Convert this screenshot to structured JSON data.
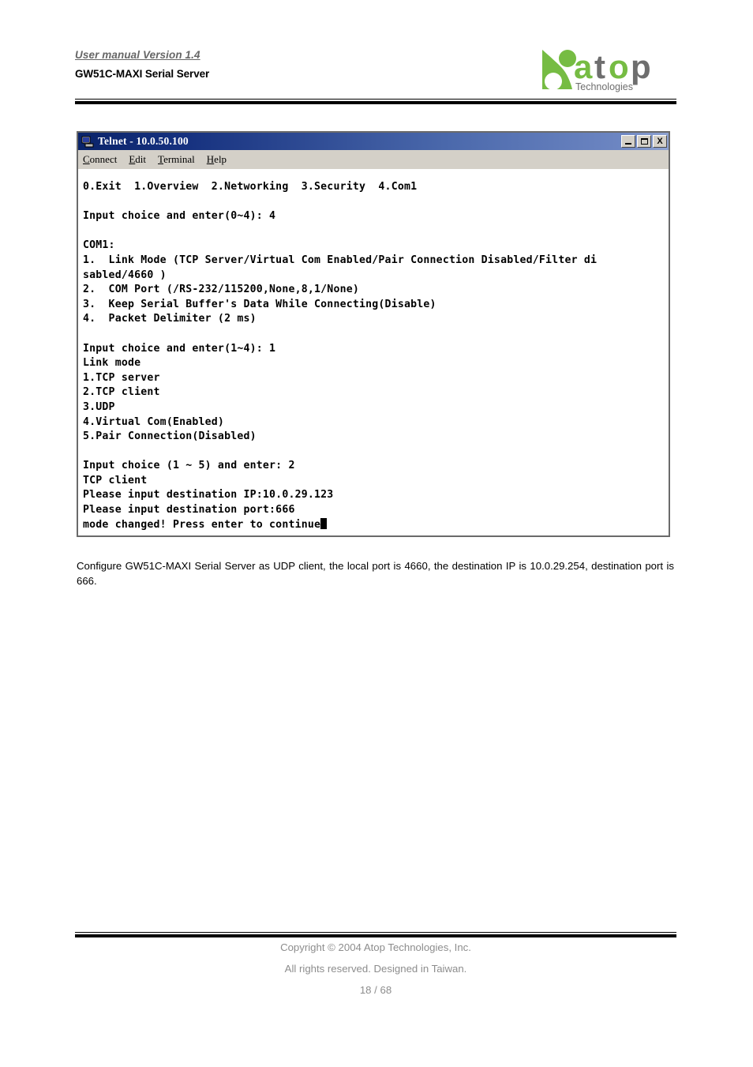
{
  "header": {
    "manual_version": "User manual Version 1.4",
    "document_title": "GW51C-MAXI Serial Server",
    "logo": {
      "wordmark": "atop",
      "tagline": "Technologies",
      "green": "#76bc43",
      "gray": "#6e6e6e"
    }
  },
  "telnet_window": {
    "title": "Telnet - 10.0.50.100",
    "title_icon": "computer-icon",
    "window_buttons": {
      "minimize": "minimize-icon",
      "maximize": "maximize-icon",
      "close": "X"
    },
    "menu": [
      {
        "label": "Connect",
        "accel": "C"
      },
      {
        "label": "Edit",
        "accel": "E"
      },
      {
        "label": "Terminal",
        "accel": "T"
      },
      {
        "label": "Help",
        "accel": "H"
      }
    ],
    "terminal_lines": [
      "0.Exit  1.Overview  2.Networking  3.Security  4.Com1",
      "",
      "Input choice and enter(0~4): 4",
      "",
      "COM1:",
      "1.  Link Mode (TCP Server/Virtual Com Enabled/Pair Connection Disabled/Filter di",
      "sabled/4660 )",
      "2.  COM Port (/RS-232/115200,None,8,1/None)",
      "3.  Keep Serial Buffer's Data While Connecting(Disable)",
      "4.  Packet Delimiter (2 ms)",
      "",
      "Input choice and enter(1~4): 1",
      "Link mode",
      "1.TCP server",
      "2.TCP client",
      "3.UDP",
      "4.Virtual Com(Enabled)",
      "5.Pair Connection(Disabled)",
      "",
      "Input choice (1 ~ 5) and enter: 2",
      "TCP client",
      "Please input destination IP:10.0.29.123",
      "Please input destination port:666"
    ],
    "cursor_line": "mode changed! Press enter to continue"
  },
  "body": {
    "paragraph": "Configure GW51C-MAXI Serial Server as UDP client, the local port is 4660, the destination IP is 10.0.29.254, destination port is 666."
  },
  "footer": {
    "copyright": "Copyright © 2004 Atop Technologies, Inc.",
    "rights": "All rights reserved. Designed in Taiwan.",
    "page_number": "18 / 68"
  }
}
